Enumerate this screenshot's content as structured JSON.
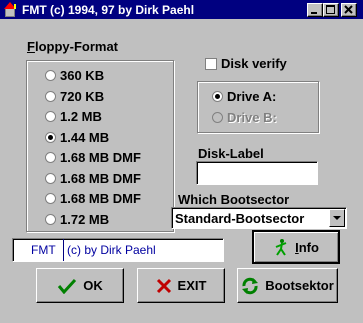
{
  "window": {
    "title": "FMT (c) 1994, 97 by Dirk Paehl"
  },
  "floppy_format": {
    "label": "Floppy-Format",
    "options": [
      "360 KB",
      "720 KB",
      "1.2 MB",
      "1.44 MB",
      "1.68 MB DMF",
      "1.68 MB DMF",
      "1.68 MB DMF",
      "1.72 MB"
    ],
    "selected_index": 3
  },
  "disk_verify": {
    "label": "Disk verify",
    "checked": false
  },
  "drive": {
    "a_label": "Drive A:",
    "b_label": "Drive B:",
    "selected": "A"
  },
  "disk_label": {
    "label": "Disk-Label",
    "value": ""
  },
  "bootsector": {
    "label": "Which Bootsector",
    "selected": "Standard-Bootsector"
  },
  "credit": {
    "fmt": "FMT",
    "text": "(c) by Dirk Paehl"
  },
  "buttons": {
    "info": "Info",
    "ok": "OK",
    "exit": "EXIT",
    "bootsektor": "Bootsektor"
  }
}
